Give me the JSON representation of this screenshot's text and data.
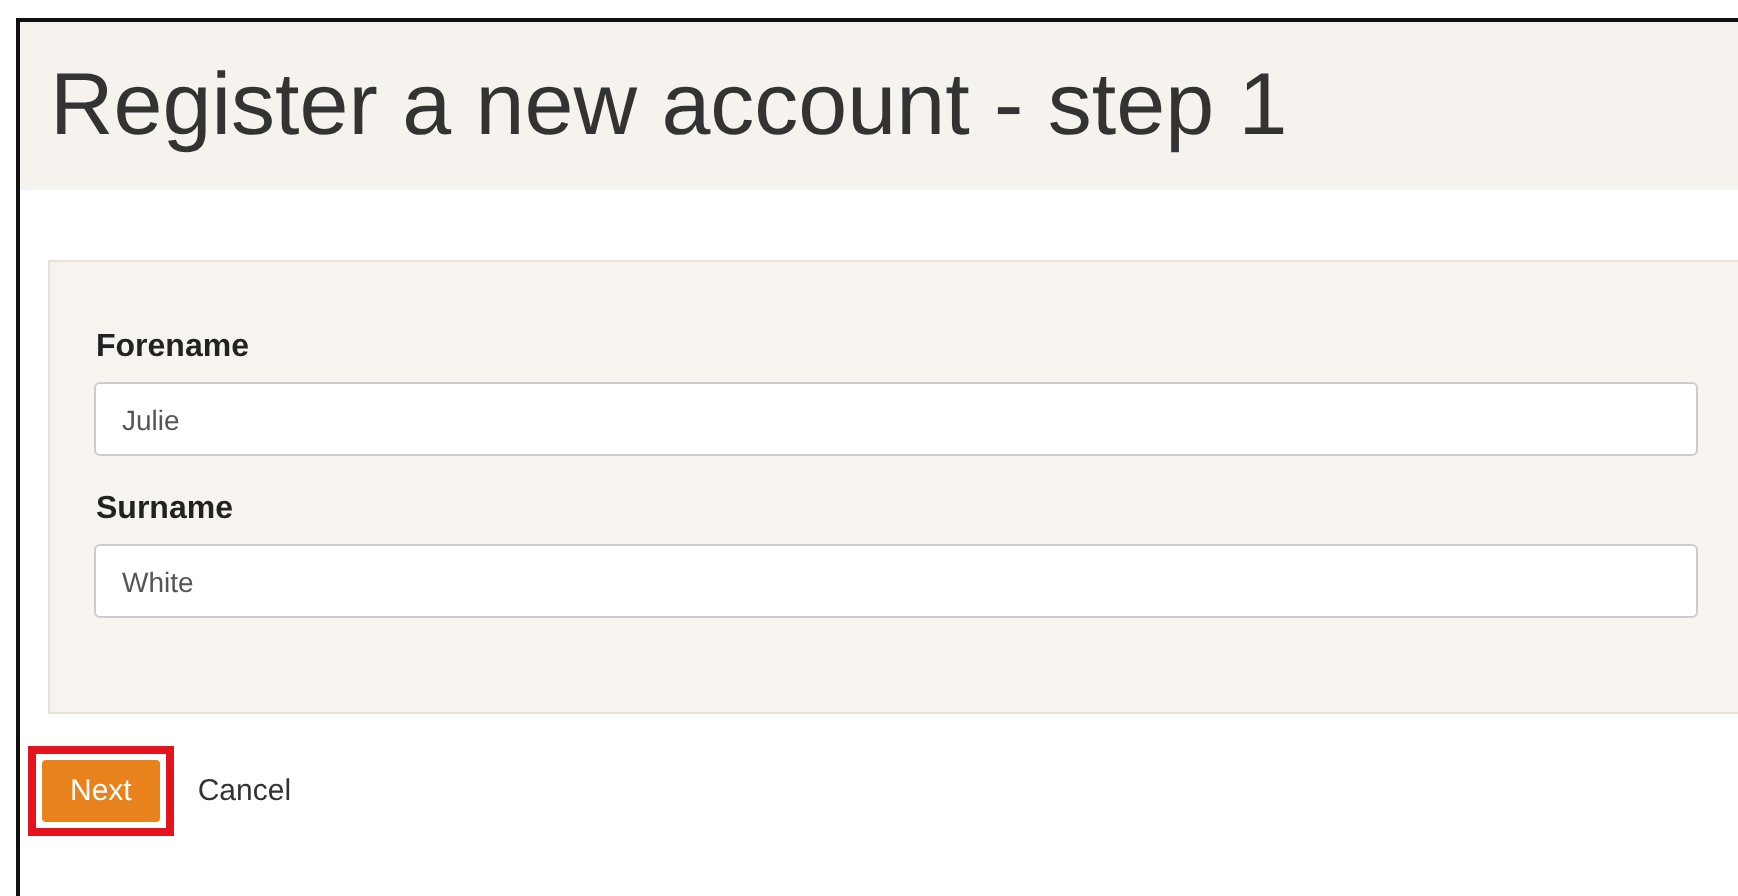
{
  "page": {
    "title": "Register a new account - step 1"
  },
  "fields": [
    {
      "label": "Forename",
      "value": "Julie"
    },
    {
      "label": "Surname",
      "value": "White"
    }
  ],
  "actions": {
    "next": {
      "label": "Next",
      "highlighted": true
    },
    "cancel": {
      "label": "Cancel"
    }
  }
}
